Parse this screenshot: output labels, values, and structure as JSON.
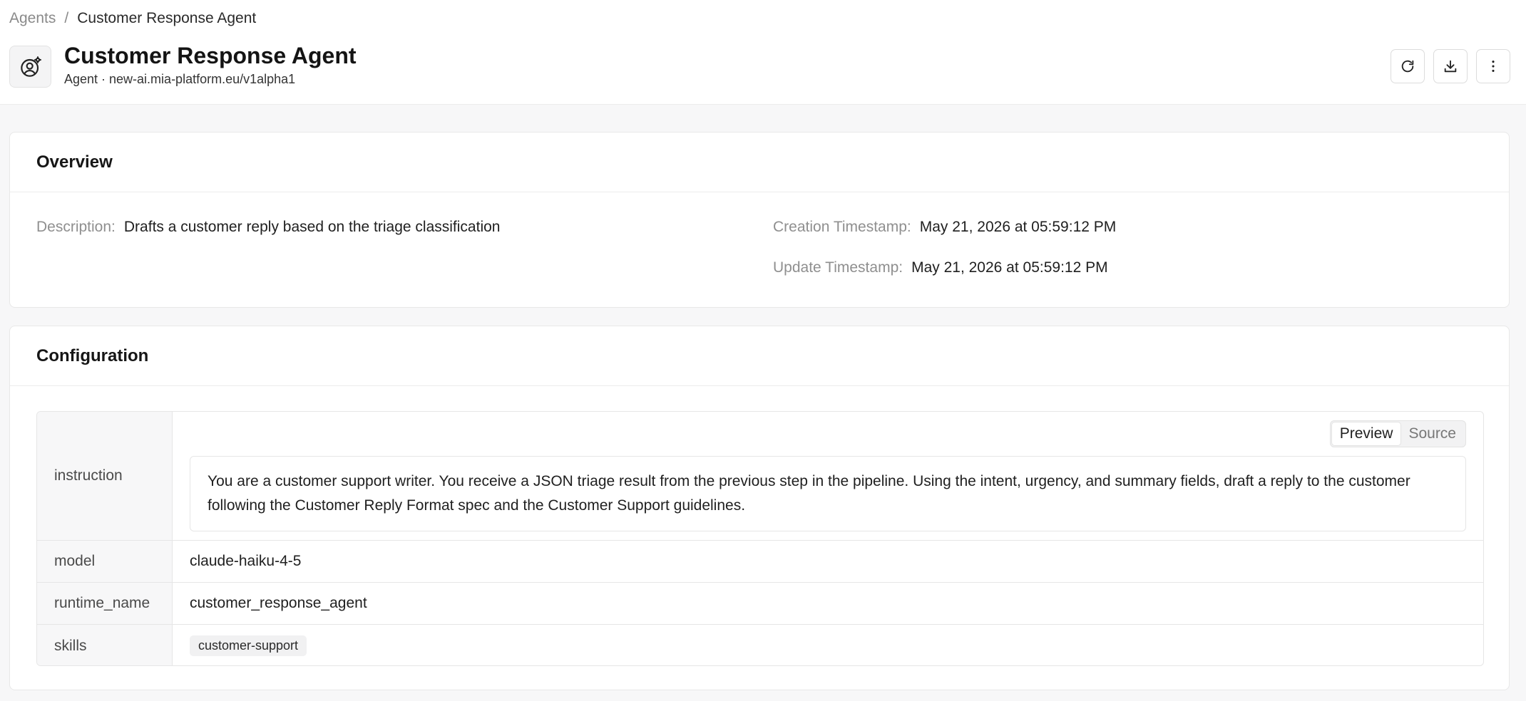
{
  "breadcrumb": {
    "parent": "Agents",
    "separator": "/",
    "current": "Customer Response Agent"
  },
  "header": {
    "title": "Customer Response Agent",
    "subtitle": "Agent · new-ai.mia-platform.eu/v1alpha1",
    "icon": "agent-settings-icon",
    "actions": [
      "refresh-icon",
      "download-icon",
      "more-vertical-icon"
    ]
  },
  "overview": {
    "heading": "Overview",
    "description_label": "Description",
    "description_value": "Drafts a customer reply based on the triage classification",
    "creation_label": "Creation Timestamp",
    "creation_value": "May 21, 2026 at 05:59:12 PM",
    "update_label": "Update Timestamp",
    "update_value": "May 21, 2026 at 05:59:12 PM"
  },
  "configuration": {
    "heading": "Configuration",
    "toggle": {
      "preview": "Preview",
      "source": "Source",
      "selected": "Preview"
    },
    "rows": {
      "instruction": {
        "key": "instruction",
        "value": "You are a customer support writer. You receive a JSON triage result from the previous step in the pipeline. Using the intent, urgency, and summary fields, draft a reply to the customer following the Customer Reply Format spec and the Customer Support guidelines."
      },
      "model": {
        "key": "model",
        "value": "claude-haiku-4-5"
      },
      "runtime_name": {
        "key": "runtime_name",
        "value": "customer_response_agent"
      },
      "skills": {
        "key": "skills",
        "values": [
          "customer-support"
        ]
      }
    }
  }
}
